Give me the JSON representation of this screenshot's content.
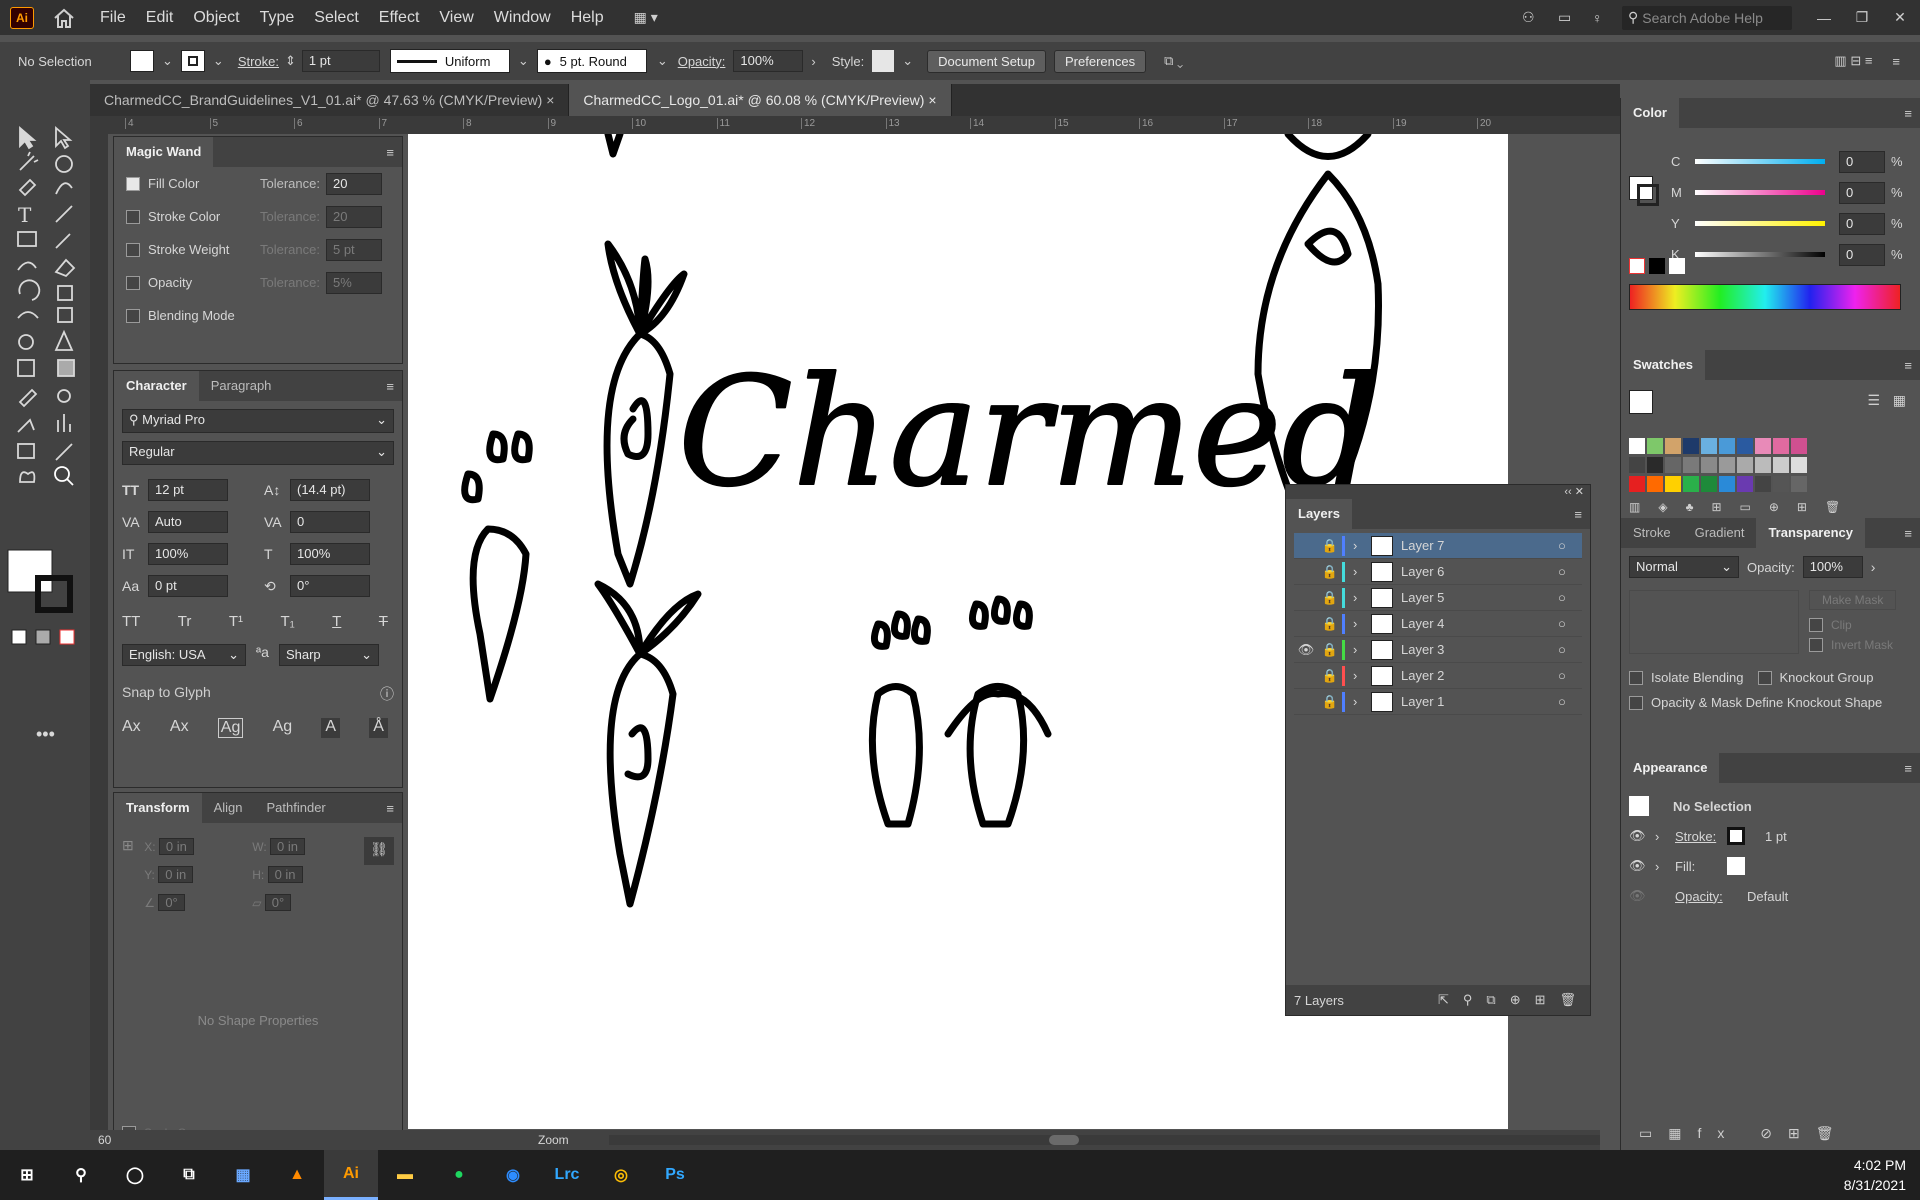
{
  "menubar": {
    "logo": "Ai",
    "items": [
      "File",
      "Edit",
      "Object",
      "Type",
      "Select",
      "Effect",
      "View",
      "Window",
      "Help"
    ],
    "search_placeholder": "Search Adobe Help"
  },
  "control": {
    "selection": "No Selection",
    "stroke_label": "Stroke:",
    "stroke_value": "1 pt",
    "uniform": "Uniform",
    "brush": "5 pt. Round",
    "opacity_label": "Opacity:",
    "opacity_value": "100%",
    "style_label": "Style:",
    "document_setup": "Document Setup",
    "preferences": "Preferences"
  },
  "tabs": [
    {
      "label": "CharmedCC_BrandGuidelines_V1_01.ai* @ 47.63 % (CMYK/Preview)"
    },
    {
      "label": "CharmedCC_Logo_01.ai* @ 60.08 % (CMYK/Preview)"
    }
  ],
  "ruler": [
    "4",
    "5",
    "6",
    "7",
    "8",
    "9",
    "10",
    "11",
    "12",
    "13",
    "14",
    "15",
    "16",
    "17",
    "18",
    "19",
    "20"
  ],
  "magic_wand": {
    "title": "Magic Wand",
    "fill_color": "Fill Color",
    "tolerance": "Tolerance:",
    "fill_tol": "20",
    "stroke_color": "Stroke Color",
    "stroke_tol": "20",
    "stroke_weight": "Stroke Weight",
    "weight_tol": "5 pt",
    "opacity": "Opacity",
    "opacity_tol": "5%",
    "blending": "Blending Mode"
  },
  "character": {
    "tab1": "Character",
    "tab2": "Paragraph",
    "font": "Myriad Pro",
    "style": "Regular",
    "size": "12 pt",
    "leading": "(14.4 pt)",
    "kerning": "Auto",
    "tracking": "0",
    "vscale": "100%",
    "hscale": "100%",
    "baseline": "0 pt",
    "rotation": "0°",
    "language": "English: USA",
    "aa": "Sharp",
    "snap": "Snap to Glyph"
  },
  "transform": {
    "tab1": "Transform",
    "tab2": "Align",
    "tab3": "Pathfinder",
    "x": "0 in",
    "y": "0 in",
    "w": "0 in",
    "h": "0 in",
    "angle": "0°",
    "shear": "0°",
    "no_props": "No Shape Properties",
    "scale_corners": "Scale Corners"
  },
  "layers": {
    "title": "Layers",
    "items": [
      {
        "name": "Layer 7",
        "color": "#4f7fff",
        "selected": true
      },
      {
        "name": "Layer 6",
        "color": "#44dcdc"
      },
      {
        "name": "Layer 5",
        "color": "#44dcdc"
      },
      {
        "name": "Layer 4",
        "color": "#4f7fff"
      },
      {
        "name": "Layer 3",
        "color": "#44dc44"
      },
      {
        "name": "Layer 2",
        "color": "#ff4f4f"
      },
      {
        "name": "Layer 1",
        "color": "#4f7fff"
      }
    ],
    "count": "7 Layers"
  },
  "color": {
    "title": "Color",
    "c": "0",
    "m": "0",
    "y": "0",
    "k": "0",
    "labels": [
      "C",
      "M",
      "Y",
      "K"
    ],
    "pct": "%"
  },
  "swatches": {
    "title": "Swatches"
  },
  "transparency": {
    "tab1": "Stroke",
    "tab2": "Gradient",
    "tab3": "Transparency",
    "mode": "Normal",
    "opacity_label": "Opacity:",
    "opacity": "100%",
    "make_mask": "Make Mask",
    "clip": "Clip",
    "invert": "Invert Mask",
    "isolate": "Isolate Blending",
    "knockout": "Knockout Group",
    "define": "Opacity & Mask Define Knockout Shape"
  },
  "appearance": {
    "title": "Appearance",
    "selection": "No Selection",
    "stroke": "Stroke:",
    "stroke_value": "1 pt",
    "fill": "Fill:",
    "opacity": "Opacity:",
    "opacity_value": "Default"
  },
  "status": {
    "zoom_value": "60",
    "zoom_label": "Zoom"
  },
  "canvas": {
    "wordmark": "Charmed"
  },
  "clock": {
    "time": "4:02 PM",
    "date": "8/31/2021"
  }
}
